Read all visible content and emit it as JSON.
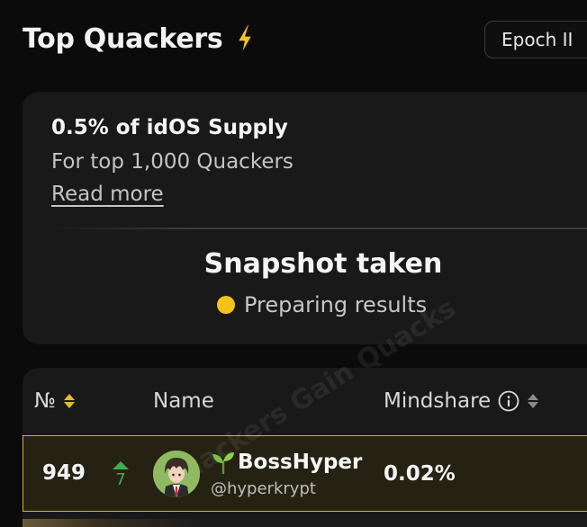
{
  "header": {
    "title": "Top Quackers",
    "title_icon": "lightning-bolt-icon",
    "epoch_label": "Epoch II"
  },
  "campaign": {
    "supply_text": "0.5% of idOS Supply",
    "subtext": "For top 1,000 Quackers",
    "read_more": "Read more",
    "snapshot_title": "Snapshot taken",
    "status_text": "Preparing results",
    "status_color": "#f4c31a"
  },
  "table": {
    "columns": {
      "rank": "№",
      "name": "Name",
      "mindshare": "Mindshare"
    },
    "rows": [
      {
        "rank": "949",
        "change": "7",
        "change_direction": "up",
        "display_name": "BossHyper",
        "name_emoji": "seedling-icon",
        "handle": "@hyperkrypt",
        "mindshare": "0.02%",
        "watermark": "Quackers Gain Quacks"
      }
    ]
  },
  "colors": {
    "background": "#0b0b0b",
    "card": "#191919",
    "highlight_border": "#c9b54a",
    "up_green": "#3cae52",
    "accent_yellow": "#f4c31a"
  }
}
